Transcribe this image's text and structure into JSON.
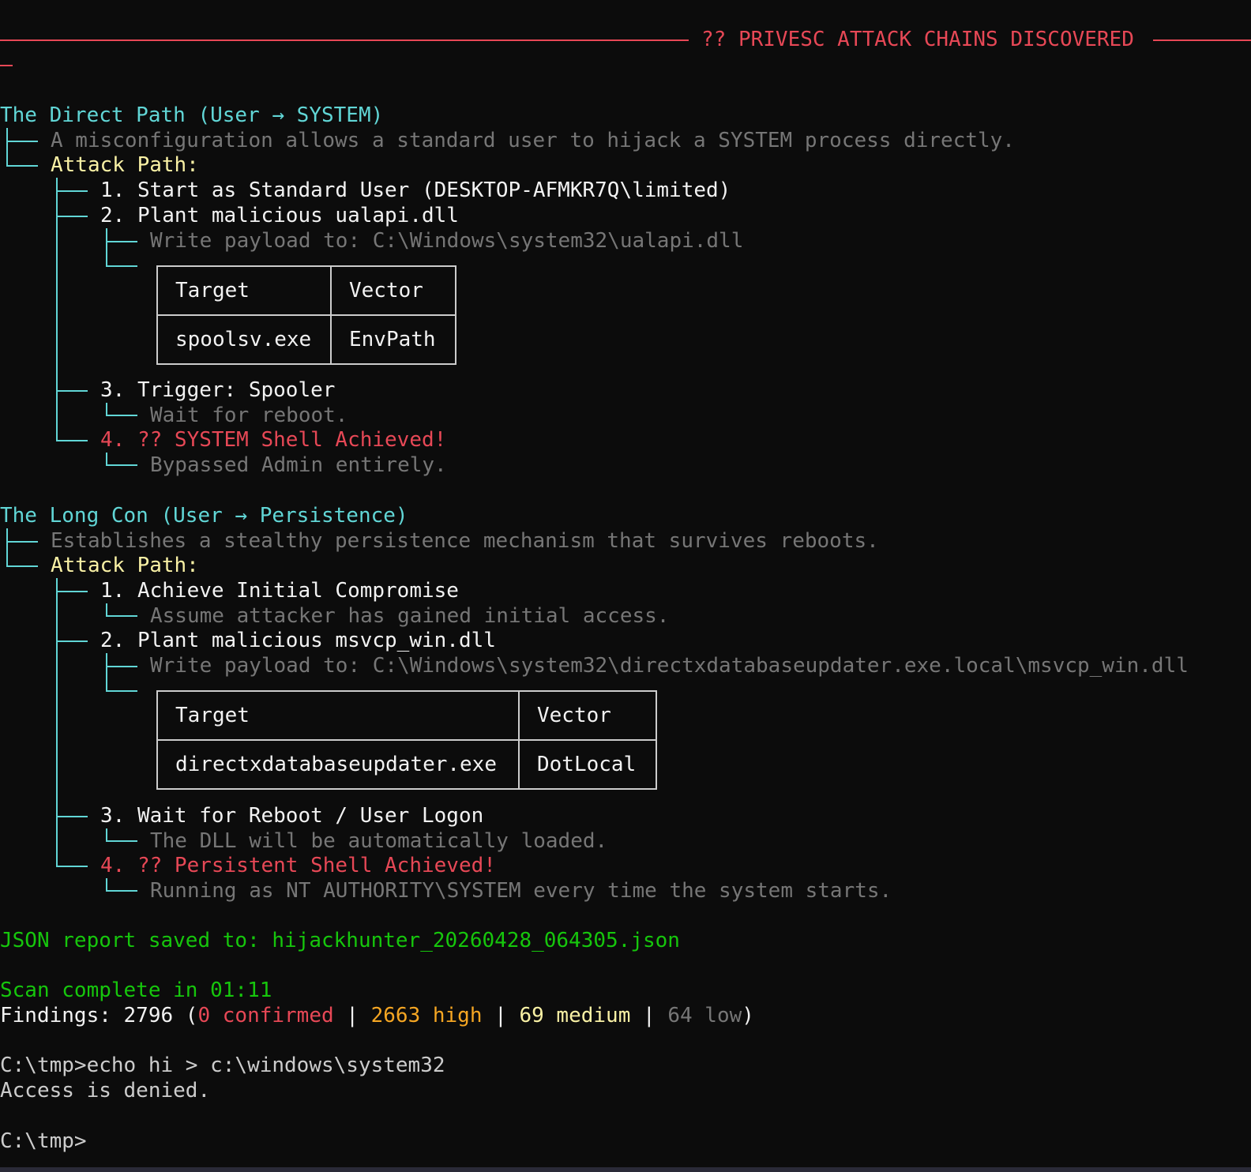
{
  "banner": {
    "title": "?? PRIVESC ATTACK CHAINS DISCOVERED"
  },
  "chain1": {
    "title": "The Direct Path (User → SYSTEM)",
    "description": "A misconfiguration allows a standard user to hijack a SYSTEM process directly.",
    "attack_path_label": "Attack Path:",
    "steps": [
      {
        "label": "1. Start as Standard User (DESKTOP-AFMKR7Q\\limited)"
      },
      {
        "label": "2. Plant malicious ualapi.dll",
        "detail": "Write payload to: C:\\Windows\\system32\\ualapi.dll",
        "table": {
          "headers": [
            "Target",
            "Vector"
          ],
          "row": [
            "spoolsv.exe",
            "EnvPath"
          ]
        }
      },
      {
        "label": "3. Trigger: Spooler",
        "detail": "Wait for reboot."
      },
      {
        "label": "4. ?? SYSTEM Shell Achieved!",
        "detail": "Bypassed Admin entirely."
      }
    ]
  },
  "chain2": {
    "title": "The Long Con (User → Persistence)",
    "description": "Establishes a stealthy persistence mechanism that survives reboots.",
    "attack_path_label": "Attack Path:",
    "steps": [
      {
        "label": "1. Achieve Initial Compromise",
        "detail": "Assume attacker has gained initial access."
      },
      {
        "label": "2. Plant malicious msvcp_win.dll",
        "detail": "Write payload to: C:\\Windows\\system32\\directxdatabaseupdater.exe.local\\msvcp_win.dll",
        "table": {
          "headers": [
            "Target",
            "Vector"
          ],
          "row": [
            "directxdatabaseupdater.exe",
            "DotLocal"
          ]
        }
      },
      {
        "label": "3. Wait for Reboot / User Logon",
        "detail": "The DLL will be automatically loaded."
      },
      {
        "label": "4. ?? Persistent Shell Achieved!",
        "detail": "Running as NT AUTHORITY\\SYSTEM every time the system starts."
      }
    ]
  },
  "report": {
    "saved": "JSON report saved to: hijackhunter_20260428_064305.json"
  },
  "scan": {
    "complete": "Scan complete in 01:11",
    "findings_prefix": "Findings: 2796 (",
    "confirmed": "0 confirmed",
    "sep": " | ",
    "high": "2663 high",
    "medium": "69 medium",
    "low": "64 low",
    "suffix": ")"
  },
  "shell": {
    "command": "C:\\tmp>echo hi > c:\\windows\\system32",
    "output": "Access is denied.",
    "prompt": "C:\\tmp>"
  },
  "colors": {
    "background": "#0c0c0c",
    "cyan": "#61d6d6",
    "yellow": "#f9f1a5",
    "red": "#e74856",
    "green": "#16c60c",
    "orange": "#f5a623",
    "dim": "#767676"
  }
}
